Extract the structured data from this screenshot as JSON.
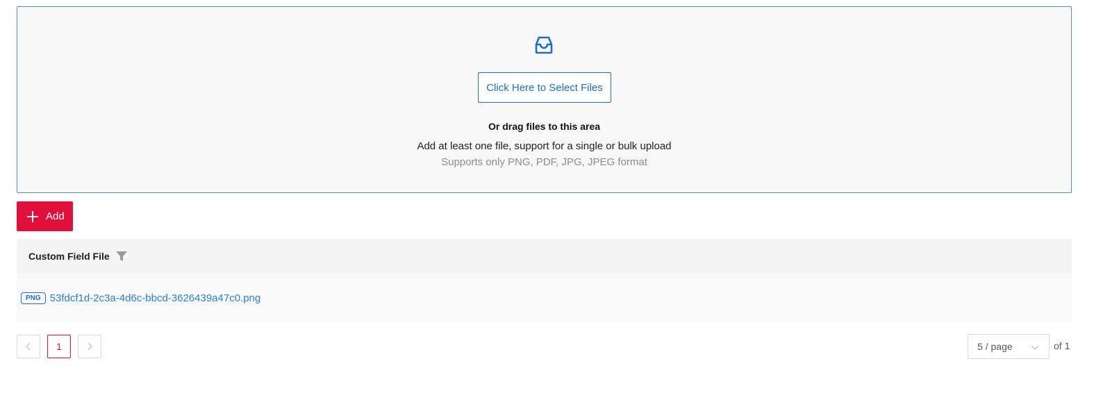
{
  "upload": {
    "select_button_label": "Click Here to Select Files",
    "drag_title": "Or drag files to this area",
    "hint": "Add at least one file, support for a single or bulk upload",
    "formats": "Supports only PNG, PDF, JPG, JPEG format",
    "icon": "inbox-icon",
    "border_color": "#4a90d9"
  },
  "toolbar": {
    "add_label": "Add",
    "add_color": "#e0103a"
  },
  "table": {
    "column_header": "Custom Field File",
    "rows": [
      {
        "badge": "PNG",
        "file_name": "53fdcf1d-2c3a-4d6c-bbcd-3626439a47c0.png"
      }
    ]
  },
  "pagination": {
    "current_page": "1",
    "page_size": "5 / page",
    "total": "of 1"
  }
}
